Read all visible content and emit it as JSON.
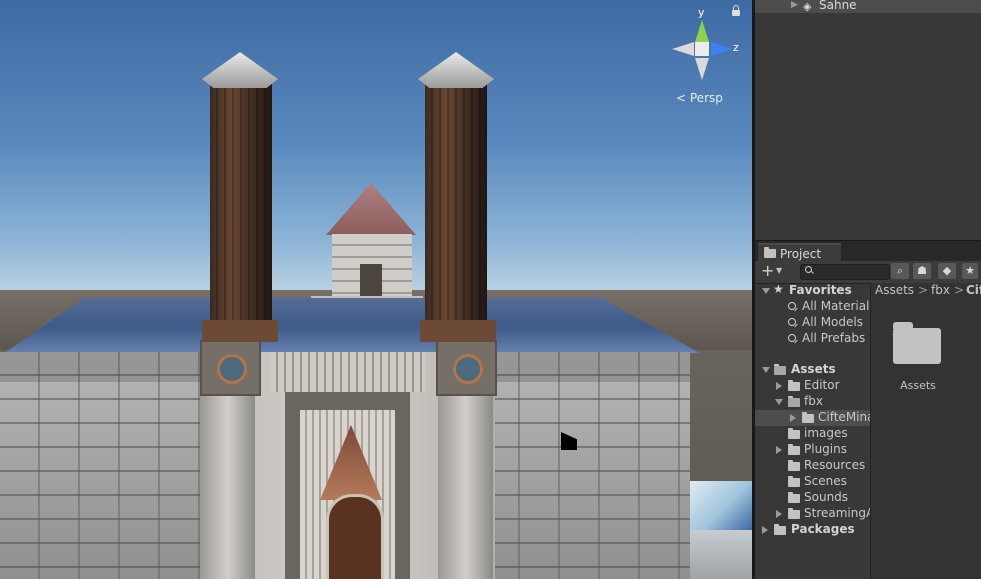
{
  "scene": {
    "gizmo": {
      "y_label": "y",
      "z_label": "z",
      "projection": "Persp"
    }
  },
  "hierarchy": {
    "scene_name": "Sahne"
  },
  "project": {
    "tab_label": "Project",
    "favorites": {
      "label": "Favorites",
      "items": [
        "All Materials",
        "All Models",
        "All Prefabs"
      ]
    },
    "assets": {
      "label": "Assets",
      "folders": [
        "Editor",
        "fbx",
        "CifteMina",
        "images",
        "Plugins",
        "Resources",
        "Scenes",
        "Sounds",
        "StreamingA"
      ]
    },
    "packages_label": "Packages",
    "breadcrumb": [
      "Assets",
      "fbx",
      "Cif"
    ],
    "breadcrumb_sep": ">",
    "grid_item_label": "Assets",
    "colors": {
      "panel": "#383838",
      "selected_row": "#4d4d4d",
      "gizmo_y": "#8fd14f",
      "gizmo_z": "#3b82f0"
    }
  }
}
